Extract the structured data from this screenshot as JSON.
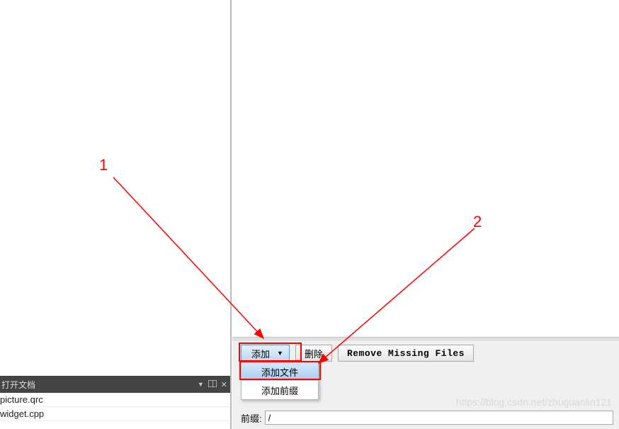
{
  "sidebar": {
    "header_title": "打开文档",
    "files": [
      "picture.qrc",
      "widget.cpp"
    ]
  },
  "toolbar": {
    "add_label": "添加",
    "delete_label": "删除",
    "remove_missing_label": "Remove Missing Files"
  },
  "dropdown": {
    "add_file": "添加文件",
    "add_prefix": "添加前缀"
  },
  "prefix": {
    "label": "前缀:",
    "value": "/"
  },
  "annotations": {
    "label1": "1",
    "label2": "2"
  },
  "watermark": "https://blog.csdn.net/zhuguanlin121"
}
